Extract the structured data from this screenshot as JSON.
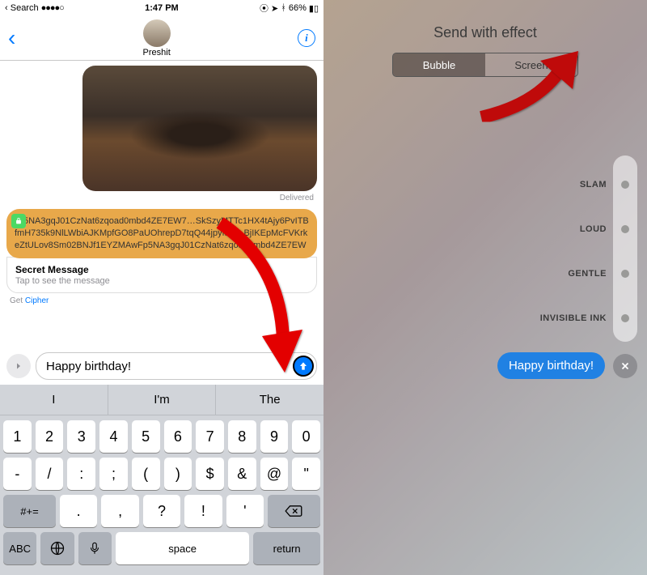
{
  "status": {
    "search_back": "Search",
    "signal": "●●●●○",
    "time": "1:47 PM",
    "battery": "66%"
  },
  "nav": {
    "contact_name": "Preshit"
  },
  "messages": {
    "delivered": "Delivered",
    "cipher_text": "…5NA3gqJ01CzNat6zqoad0mbd4ZE7EW7…SkSzyMTTc1HX4tAjy6PvITBfmH735k9NlLWbiAJKMpfGO8PaUOhrepD7tqQ44jpyMZ…BjIKEpMcFVKrkeZtULov8Sm02BNJf1EYZMAwFp5NA3gqJ01CzNat6zqoad0mbd4ZE7EW",
    "secret_title": "Secret Message",
    "secret_sub": "Tap to see the message",
    "get_label": "Get",
    "app_name": "Cipher"
  },
  "compose": {
    "text": "Happy birthday!"
  },
  "suggestions": [
    "I",
    "I'm",
    "The"
  ],
  "key_rows": {
    "r1": [
      "1",
      "2",
      "3",
      "4",
      "5",
      "6",
      "7",
      "8",
      "9",
      "0"
    ],
    "r2": [
      "-",
      "/",
      ":",
      ";",
      "(",
      ")",
      "$",
      "&",
      "@",
      "\""
    ],
    "r3_shift": "#+=",
    "r3": [
      ".",
      ",",
      "?",
      "!",
      "'"
    ],
    "r4_abc": "ABC",
    "r4_space": "space",
    "r4_return": "return"
  },
  "effect": {
    "title": "Send with effect",
    "tabs": {
      "bubble": "Bubble",
      "screen": "Screen"
    },
    "options": [
      "SLAM",
      "LOUD",
      "GENTLE",
      "INVISIBLE INK"
    ],
    "preview_text": "Happy birthday!"
  }
}
